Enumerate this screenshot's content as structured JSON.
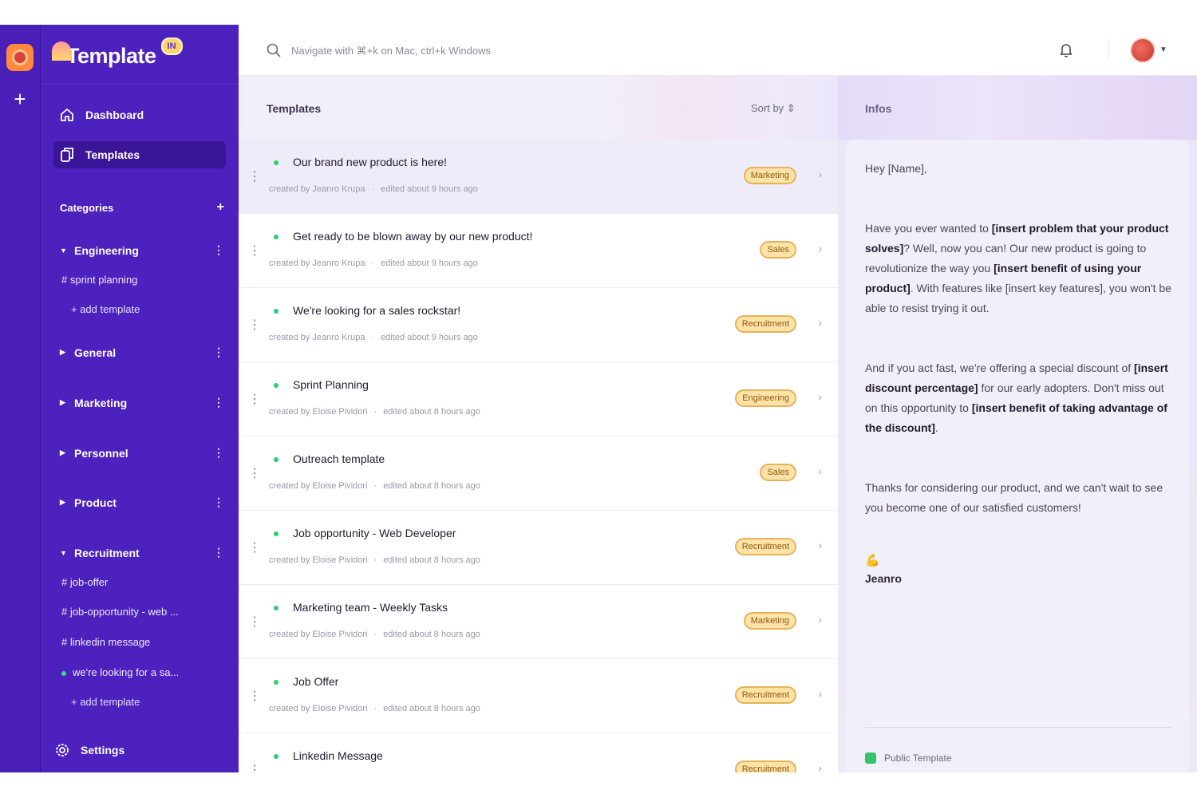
{
  "app": {
    "brand": "Template",
    "brand_badge": "IN"
  },
  "topbar": {
    "search_placeholder": "Navigate with ⌘+k on Mac, ctrl+k Windows"
  },
  "sidebar": {
    "nav": [
      {
        "label": "Dashboard",
        "icon": "home-icon"
      },
      {
        "label": "Templates",
        "icon": "templates-icon",
        "active": true
      }
    ],
    "categories_label": "Categories",
    "categories": [
      {
        "label": "Engineering",
        "expanded": true,
        "items": [
          "# sprint planning"
        ],
        "add_label": "+ add template"
      },
      {
        "label": "General",
        "expanded": false
      },
      {
        "label": "Marketing",
        "expanded": false
      },
      {
        "label": "Personnel",
        "expanded": false
      },
      {
        "label": "Product",
        "expanded": false
      },
      {
        "label": "Recruitment",
        "expanded": true,
        "items": [
          "# job-offer",
          "# job-opportunity - web ...",
          "# linkedin message",
          "we're looking for a sa..."
        ],
        "add_label": "+ add template"
      }
    ],
    "settings_label": "Settings"
  },
  "list": {
    "title": "Templates",
    "sort_label": "Sort by ⇕",
    "rows": [
      {
        "title": "Our brand new product is here!",
        "created": "created by Jeanro Krupa",
        "edited": "edited about 9 hours ago",
        "tag": "Marketing"
      },
      {
        "title": "Get ready to be blown away by our new product!",
        "created": "created by Jeanro Krupa",
        "edited": "edited about 9 hours ago",
        "tag": "Sales"
      },
      {
        "title": "We're looking for a sales rockstar!",
        "created": "created by Jeanro Krupa",
        "edited": "edited about 9 hours ago",
        "tag": "Recruitment"
      },
      {
        "title": "Sprint Planning",
        "created": "created by Eloise Pividori",
        "edited": "edited about 8 hours ago",
        "tag": "Engineering"
      },
      {
        "title": "Outreach template",
        "created": "created by Eloise Pividori",
        "edited": "edited about 8 hours ago",
        "tag": "Sales"
      },
      {
        "title": "Job opportunity - Web Developer",
        "created": "created by Eloise Pividori",
        "edited": "edited about 8 hours ago",
        "tag": "Recruitment"
      },
      {
        "title": "Marketing team - Weekly Tasks",
        "created": "created by Eloise Pividori",
        "edited": "edited about 8 hours ago",
        "tag": "Marketing"
      },
      {
        "title": "Job Offer",
        "created": "created by Eloise Pividori",
        "edited": "edited about 8 hours ago",
        "tag": "Recruitment"
      },
      {
        "title": "Linkedin Message",
        "created": "",
        "edited": "",
        "tag": "Recruitment"
      }
    ]
  },
  "infos": {
    "title": "Infos",
    "greeting": "Hey [Name],",
    "p1_a": "Have you ever wanted to ",
    "p1_b": "[insert problem that your product solves]",
    "p1_c": "? Well, now you can! Our new product is going to revolutionize the way you ",
    "p1_d": "[insert benefit of using your product]",
    "p1_e": ". With features like [insert key features], you won't be able to resist trying it out.",
    "p2_a": "And if you act fast, we're offering a special discount of ",
    "p2_b": "[insert discount percentage]",
    "p2_c": " for our early adopters. Don't miss out on this opportunity to ",
    "p2_d": "[insert benefit of taking advantage of the discount]",
    "p2_e": ".",
    "p3": "Thanks for considering our product, and we can't wait to see you become one of our satisfied customers!",
    "emoji": "💪",
    "signature": "Jeanro",
    "public_label": "Public Template"
  }
}
